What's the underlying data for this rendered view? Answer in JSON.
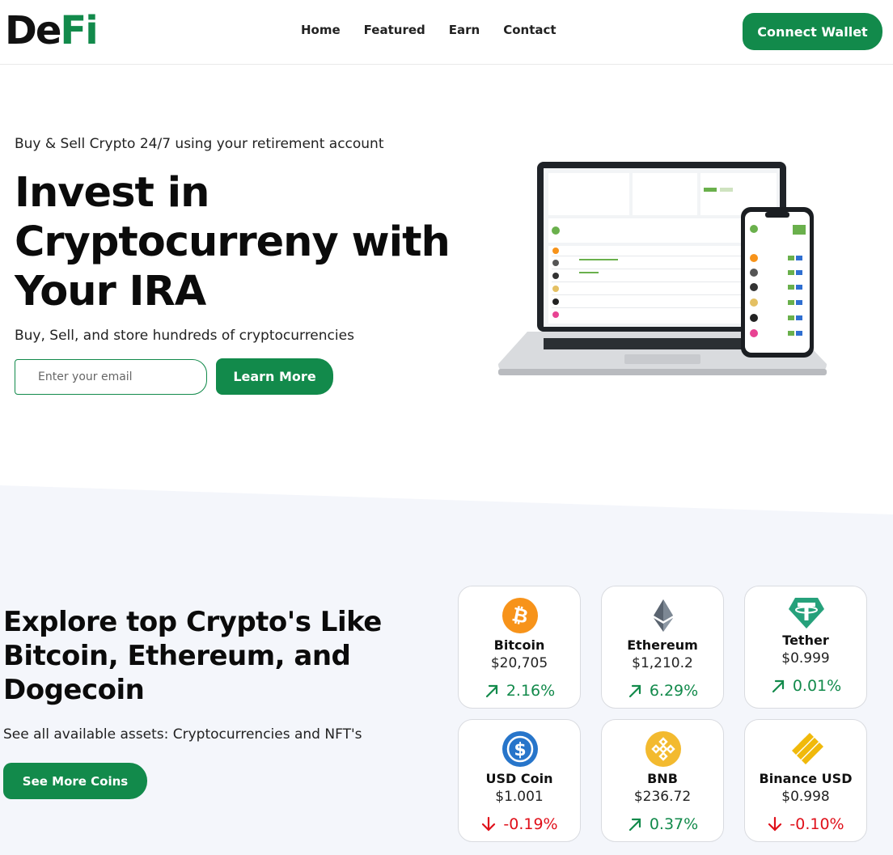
{
  "brand": {
    "logo_part1": "De",
    "logo_part2": "Fi",
    "accent_color": "#128a4b"
  },
  "nav": {
    "items": [
      {
        "label": "Home"
      },
      {
        "label": "Featured"
      },
      {
        "label": "Earn"
      },
      {
        "label": "Contact"
      }
    ],
    "connect_label": "Connect Wallet"
  },
  "hero": {
    "subtitle": "Buy & Sell Crypto 24/7 using your retirement account",
    "title": "Invest in Cryptocurreny with Your IRA",
    "description": "Buy, Sell, and store hundreds of cryptocurrencies",
    "email_placeholder": "Enter your email",
    "learn_more_label": "Learn More"
  },
  "explore": {
    "title": "Explore top Crypto's Like Bitcoin, Ethereum, and Dogecoin",
    "description": "See all available assets: Cryptocurrencies and NFT's",
    "button_label": "See More Coins"
  },
  "coins": [
    {
      "name": "Bitcoin",
      "price": "$20,705",
      "change": "2.16%",
      "direction": "up",
      "icon": "bitcoin-icon",
      "color": "#f7931a"
    },
    {
      "name": "Ethereum",
      "price": "$1,210.2",
      "change": "6.29%",
      "direction": "up",
      "icon": "ethereum-icon",
      "color": "#627eea"
    },
    {
      "name": "Tether",
      "price": "$0.999",
      "change": "0.01%",
      "direction": "up",
      "icon": "tether-icon",
      "color": "#26a17b"
    },
    {
      "name": "USD Coin",
      "price": "$1.001",
      "change": "-0.19%",
      "direction": "down",
      "icon": "usd-coin-icon",
      "color": "#2775ca"
    },
    {
      "name": "BNB",
      "price": "$236.72",
      "change": "0.37%",
      "direction": "up",
      "icon": "bnb-icon",
      "color": "#f3ba2f"
    },
    {
      "name": "Binance USD",
      "price": "$0.998",
      "change": "-0.10%",
      "direction": "down",
      "icon": "binance-usd-icon",
      "color": "#f0b90b"
    }
  ]
}
